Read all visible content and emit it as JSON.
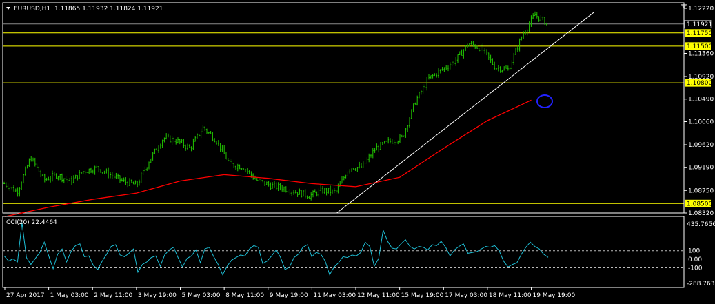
{
  "header": {
    "symbol": "EURUSD,H1",
    "ohlc": "1.11865 1.11932 1.11824 1.11921"
  },
  "indicator": {
    "label": "CCI(20) 22.4464",
    "axis_max_label": "435.7656",
    "axis_min_label": "-288.7633",
    "levels": [
      "100",
      "0.00",
      "-100"
    ]
  },
  "colors": {
    "background": "#000000",
    "candles": "#22c600",
    "moving_average": "#ff0000",
    "support_resistance": "#ffff00",
    "trendline": "#ffffff",
    "cci_line": "#1fbfd6",
    "marker_circle": "#2222ff",
    "price_tag": "#ffff00",
    "axis_text": "#ffffff"
  },
  "chart_data": [
    {
      "type": "candlestick",
      "symbol": "EURUSD",
      "timeframe": "H1",
      "ylim": [
        1.0832,
        1.1222
      ],
      "y_tick_labels": [
        "1.12220",
        "1.11360",
        "1.10920",
        "1.10490",
        "1.10060",
        "1.09620",
        "1.09190",
        "1.08750",
        "1.08320"
      ],
      "x_tick_labels": [
        "27 Apr 2017",
        "1 May 03:00",
        "2 May 11:00",
        "3 May 19:00",
        "5 May 03:00",
        "8 May 11:00",
        "9 May 19:00",
        "11 May 03:00",
        "12 May 11:00",
        "15 May 19:00",
        "17 May 03:00",
        "18 May 11:00",
        "19 May 19:00"
      ],
      "current_price": "1.11921",
      "horizontal_lines": [
        {
          "label": "1.11750",
          "value": 1.1175
        },
        {
          "label": "1.11500",
          "value": 1.115
        },
        {
          "label": "1.10800",
          "value": 1.108
        },
        {
          "label": "1.08500",
          "value": 1.085
        }
      ],
      "trendline": {
        "from": [
          "11 May 03:00",
          1.0832
        ],
        "to": [
          "19 May 19:00",
          1.1215
        ]
      },
      "close_series": [
        [
          "27 Apr 2017",
          1.0888
        ],
        [
          "28 Apr",
          1.0873
        ],
        [
          "28 Apr",
          1.0938
        ],
        [
          "1 May 03:00",
          1.0895
        ],
        [
          "1 May",
          1.0905
        ],
        [
          "2 May",
          1.0892
        ],
        [
          "2 May 11:00",
          1.0912
        ],
        [
          "2 May",
          1.0918
        ],
        [
          "3 May",
          1.0905
        ],
        [
          "3 May 19:00",
          1.0892
        ],
        [
          "4 May",
          1.0885
        ],
        [
          "4 May",
          1.0935
        ],
        [
          "4 May",
          1.0975
        ],
        [
          "5 May 03:00",
          1.097
        ],
        [
          "5 May",
          1.0955
        ],
        [
          "5 May",
          1.0995
        ],
        [
          "8 May",
          1.097
        ],
        [
          "8 May 11:00",
          1.0925
        ],
        [
          "8 May",
          1.092
        ],
        [
          "9 May",
          1.0895
        ],
        [
          "9 May 19:00",
          1.0885
        ],
        [
          "10 May",
          1.088
        ],
        [
          "10 May",
          1.0872
        ],
        [
          "11 May 03:00",
          1.0865
        ],
        [
          "11 May",
          1.0875
        ],
        [
          "12 May",
          1.0872
        ],
        [
          "12 May 11:00",
          1.0918
        ],
        [
          "12 May",
          1.092
        ],
        [
          "15 May",
          1.0955
        ],
        [
          "15 May 19:00",
          1.0968
        ],
        [
          "16 May",
          1.0975
        ],
        [
          "16 May",
          1.1045
        ],
        [
          "16 May",
          1.1088
        ],
        [
          "17 May 03:00",
          1.1105
        ],
        [
          "17 May",
          1.1122
        ],
        [
          "17 May",
          1.1155
        ],
        [
          "18 May",
          1.1145
        ],
        [
          "18 May 11:00",
          1.111
        ],
        [
          "18 May",
          1.1105
        ],
        [
          "19 May",
          1.1168
        ],
        [
          "19 May",
          1.121
        ],
        [
          "19 May 19:00",
          1.1192
        ]
      ],
      "moving_average": [
        [
          "27 Apr 2017",
          1.0825
        ],
        [
          "1 May 03:00",
          1.0843
        ],
        [
          "2 May 11:00",
          1.0858
        ],
        [
          "3 May 19:00",
          1.087
        ],
        [
          "5 May 03:00",
          1.0893
        ],
        [
          "8 May 11:00",
          1.0905
        ],
        [
          "9 May 19:00",
          1.0898
        ],
        [
          "11 May 03:00",
          1.0888
        ],
        [
          "12 May 11:00",
          1.0882
        ],
        [
          "15 May 19:00",
          1.09
        ],
        [
          "17 May 03:00",
          1.0955
        ],
        [
          "18 May 11:00",
          1.1008
        ],
        [
          "19 May 19:00",
          1.1047
        ]
      ]
    },
    {
      "type": "line",
      "name": "CCI(20)",
      "ylim": [
        -288.7633,
        435.7656
      ],
      "levels": [
        100,
        0,
        -100
      ],
      "last_value": 22.4464,
      "values": [
        40,
        -20,
        5,
        -30,
        430,
        20,
        -60,
        10,
        80,
        200,
        40,
        -110,
        60,
        120,
        -30,
        90,
        160,
        180,
        30,
        40,
        -70,
        -120,
        -20,
        60,
        150,
        170,
        50,
        30,
        70,
        120,
        -150,
        -60,
        -30,
        20,
        40,
        -80,
        50,
        110,
        140,
        20,
        -90,
        10,
        40,
        110,
        -40,
        120,
        140,
        30,
        -60,
        -180,
        -80,
        -10,
        20,
        50,
        40,
        120,
        160,
        140,
        -50,
        -20,
        40,
        110,
        20,
        -120,
        -90,
        20,
        60,
        140,
        170,
        30,
        80,
        60,
        -20,
        -180,
        -90,
        -40,
        30,
        20,
        50,
        40,
        80,
        200,
        150,
        -80,
        10,
        340,
        210,
        130,
        120,
        180,
        230,
        150,
        120,
        150,
        140,
        110,
        170,
        160,
        210,
        140,
        40,
        110,
        150,
        180,
        70,
        80,
        90,
        120,
        150,
        140,
        160,
        100,
        -20,
        -90,
        -60,
        -40,
        60,
        140,
        200,
        150,
        120,
        60,
        22.4464
      ]
    }
  ]
}
